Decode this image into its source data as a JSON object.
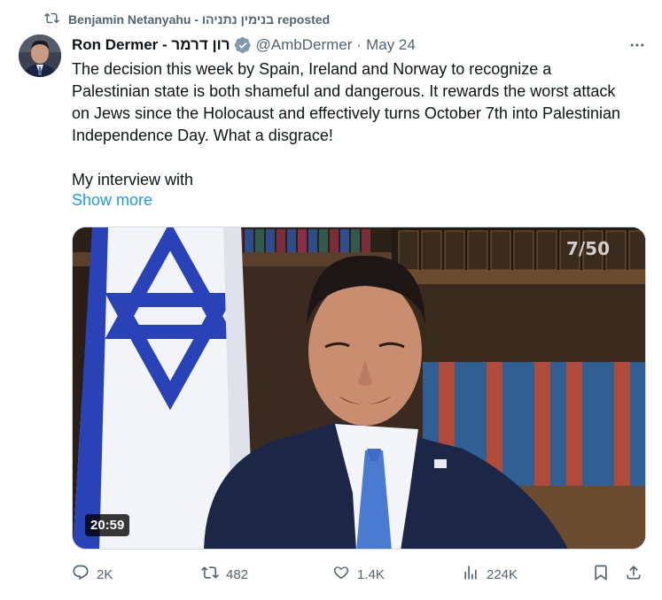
{
  "repost": {
    "text": "Benjamin Netanyahu - בנימין נתניהו reposted"
  },
  "author": {
    "name": "Ron Dermer - רון דרמר",
    "handle": "@AmbDermer",
    "separator": "·",
    "date": "May 24"
  },
  "tweet": {
    "paragraph1": "The decision this week by Spain, Ireland and Norway to recognize a Palestinian state is both shameful and dangerous. It rewards the worst attack on Jews since the Holocaust and effectively turns October 7th into Palestinian Independence Day. What a disgrace!",
    "paragraph2": "My interview with",
    "show_more": "Show more"
  },
  "media": {
    "duration": "20:59",
    "channel_logo": "7/50"
  },
  "actions": {
    "replies": "2K",
    "reposts": "482",
    "likes": "1.4K",
    "views": "224K"
  },
  "icons": [
    "repost-icon",
    "verified-icon",
    "more-icon",
    "reply-icon",
    "like-icon",
    "views-icon",
    "bookmark-icon",
    "share-icon"
  ],
  "colors": {
    "link": "#1d9bf0",
    "muted": "#536471",
    "verified_gray": "#829aab"
  }
}
